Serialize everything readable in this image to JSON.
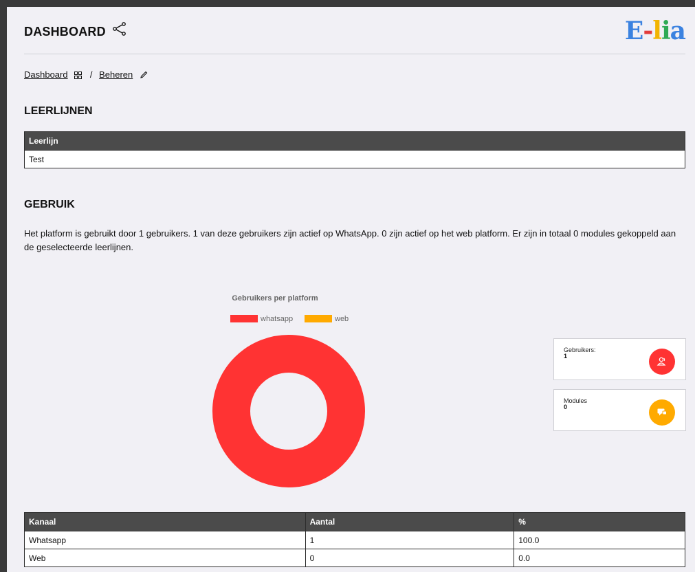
{
  "header": {
    "title": "DASHBOARD",
    "logo_parts": [
      "E",
      "-",
      "l",
      "i",
      "a"
    ]
  },
  "breadcrumb": {
    "item1": "Dashboard",
    "separator": "/",
    "item2": "Beheren"
  },
  "leerlijnen": {
    "heading": "LEERLIJNEN",
    "column": "Leerlijn",
    "rows": [
      "Test"
    ]
  },
  "gebruik": {
    "heading": "GEBRUIK",
    "description": "Het platform is gebruikt door 1 gebruikers. 1 van deze gebruikers zijn actief op WhatsApp. 0 zijn actief op het web platform. Er zijn in totaal 0 modules gekoppeld aan de geselecteerde leerlijnen."
  },
  "chart_data": {
    "type": "pie",
    "title": "Gebruikers per platform",
    "categories": [
      "whatsapp",
      "web"
    ],
    "values": [
      1,
      0
    ],
    "colors": [
      "#ff3333",
      "#ffaa00"
    ],
    "legend": "top",
    "donut": true
  },
  "cards": [
    {
      "label": "Gebruikers:",
      "value": "1",
      "color": "#ff3333",
      "icon": "users-icon"
    },
    {
      "label": "Modules",
      "value": "0",
      "color": "#ffaa00",
      "icon": "chat-icon"
    }
  ],
  "kanaal_table": {
    "columns": [
      "Kanaal",
      "Aantal",
      "%"
    ],
    "rows": [
      [
        "Whatsapp",
        "1",
        "100.0"
      ],
      [
        "Web",
        "0",
        "0.0"
      ]
    ]
  }
}
